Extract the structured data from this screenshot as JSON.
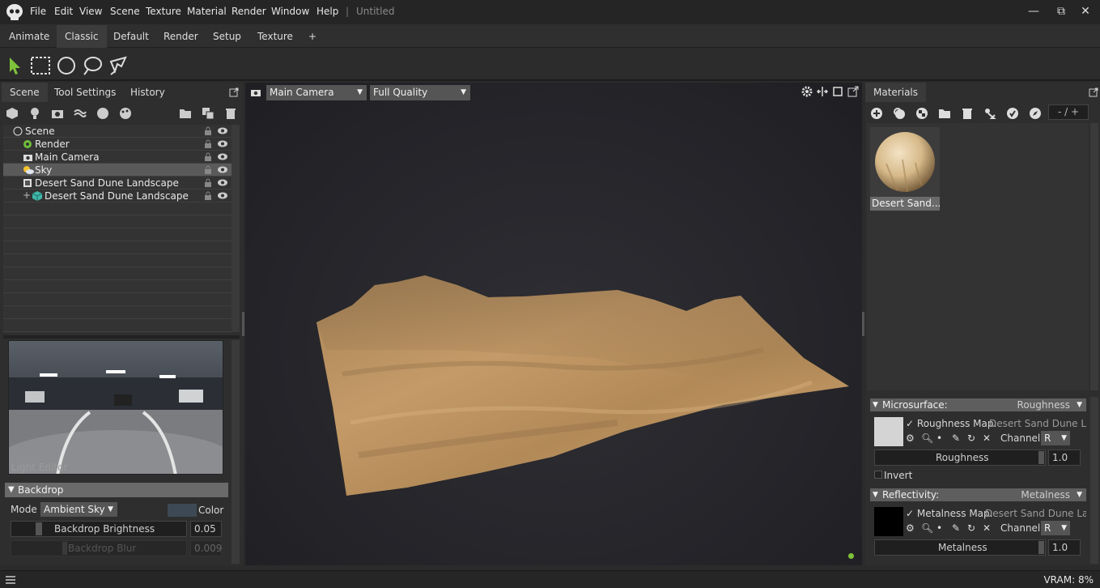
{
  "menu": {
    "items": [
      "File",
      "Edit",
      "View",
      "Scene",
      "Texture",
      "Material",
      "Render",
      "Window",
      "Help"
    ],
    "separator": "|",
    "doc_title": "Untitled"
  },
  "window_controls": {
    "minimize": "—",
    "restore": "⧉",
    "close": "✕"
  },
  "workspace_tabs": [
    "Animate",
    "Classic",
    "Default",
    "Render",
    "Setup",
    "Texture",
    "+"
  ],
  "active_workspace": "Classic",
  "left_panel": {
    "tabs": [
      "Scene",
      "Tool Settings",
      "History"
    ],
    "active_tab": "Scene",
    "tree": [
      {
        "label": "Scene",
        "indent": 0,
        "icon": "scene-icon"
      },
      {
        "label": "Render",
        "indent": 1,
        "icon": "render-gear-icon"
      },
      {
        "label": "Main Camera",
        "indent": 1,
        "icon": "camera-icon"
      },
      {
        "label": "Sky",
        "indent": 1,
        "icon": "sky-icon",
        "selected": true
      },
      {
        "label": "Desert Sand Dune Landscape",
        "indent": 1,
        "icon": "object-icon"
      },
      {
        "label": "Desert Sand Dune Landscape",
        "indent": 2,
        "icon": "mesh-cube-icon"
      }
    ],
    "light_editor_label": "Light Editor",
    "backdrop": {
      "title": "Backdrop",
      "mode_label": "Mode",
      "mode_value": "Ambient Sky",
      "color_label": "Color",
      "brightness_label": "Backdrop Brightness",
      "brightness_value": "0.05",
      "blur_label": "Backdrop Blur",
      "blur_value": "0.009"
    }
  },
  "viewport": {
    "camera": "Main Camera",
    "quality": "Full Quality"
  },
  "right_panel": {
    "tab": "Materials",
    "counter": "- / +",
    "material_name": "Desert Sand...",
    "microsurface": {
      "title": "Microsurface:",
      "mode": "Roughness",
      "map_label": "Roughness Map:",
      "map_value": "Desert Sand Dune Land",
      "channel_label": "Channel",
      "channel_value": "R",
      "slider_label": "Roughness",
      "slider_value": "1.0",
      "invert_label": "Invert"
    },
    "reflectivity": {
      "title": "Reflectivity:",
      "mode": "Metalness",
      "map_label": "Metalness Map:",
      "map_value": "Desert Sand Dune Land:",
      "channel_label": "Channel",
      "channel_value": "R",
      "slider_label": "Metalness",
      "slider_value": "1.0"
    }
  },
  "status": {
    "vram": "VRAM: 8%"
  },
  "colors": {
    "accent_green": "#7ec23a",
    "sand": "#b88d5a",
    "panel_bg": "#2e2e2e"
  }
}
